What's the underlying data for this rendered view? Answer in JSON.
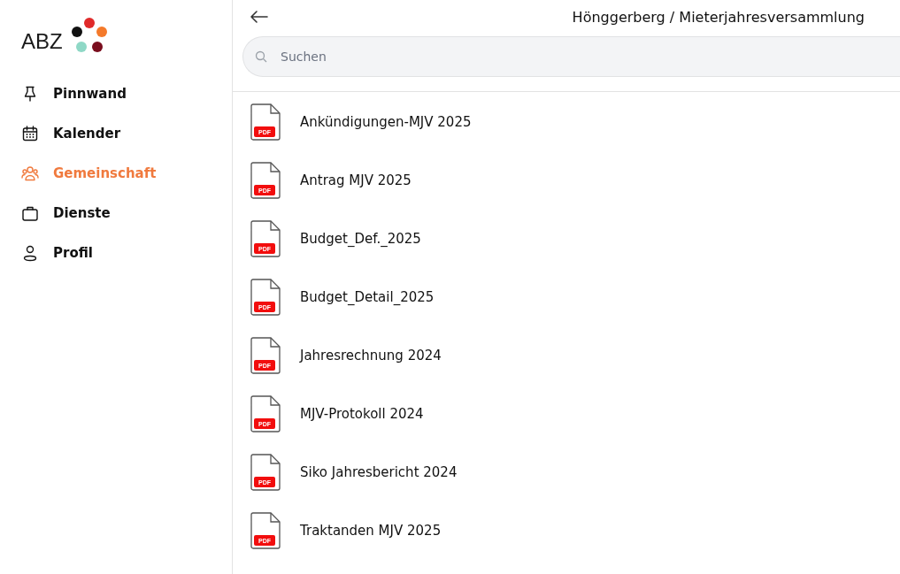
{
  "sidebar": {
    "logo": "ABZ",
    "items": [
      {
        "label": "Pinnwand",
        "kind": "pinboard",
        "selected": false
      },
      {
        "label": "Kalender",
        "kind": "calendar",
        "selected": false
      },
      {
        "label": "Gemeinschaft",
        "kind": "community",
        "selected": true
      },
      {
        "label": "Dienste",
        "kind": "services",
        "selected": false
      },
      {
        "label": "Profil",
        "kind": "profile",
        "selected": false
      }
    ]
  },
  "header": {
    "title": "Hönggerberg / Mieterjahresversammlung"
  },
  "search": {
    "placeholder": "Suchen"
  },
  "files": [
    {
      "name": "Ankündigungen-MJV 2025",
      "badge": "PDF"
    },
    {
      "name": "Antrag MJV 2025",
      "badge": "PDF"
    },
    {
      "name": "Budget_Def._2025",
      "badge": "PDF"
    },
    {
      "name": "Budget_Detail_2025",
      "badge": "PDF"
    },
    {
      "name": "Jahresrechnung 2024",
      "badge": "PDF"
    },
    {
      "name": "MJV-Protokoll 2024",
      "badge": "PDF"
    },
    {
      "name": "Siko Jahresbericht 2024",
      "badge": "PDF"
    },
    {
      "name": "Traktanden MJV 2025",
      "badge": "PDF"
    }
  ]
}
